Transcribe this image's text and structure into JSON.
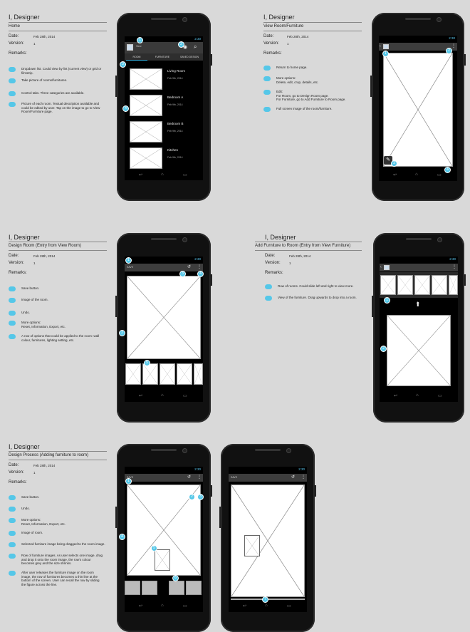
{
  "panels": [
    {
      "title": "I, Designer",
      "screen": "Home",
      "date_label": "Date:",
      "date": "Feb 28th, 2014",
      "version_label": "Version:",
      "version": "1",
      "remarks_label": "Remarks:",
      "remarks": [
        "Dropdown list. Could view by list (current view) or grid or filmstrip.",
        "Take picture of rooms/furnitures.",
        "Control tabs. Three categories are available.",
        "Picture of each room. Textual description available and could be edited by user. Tap on the image to go to View Room/Furniture page."
      ],
      "phone": {
        "status_time": "2:30",
        "action_dropdown": "View",
        "tabs": [
          "ROOM",
          "FURNITURE",
          "SAVED DESIGN"
        ],
        "list": [
          {
            "title": "Living Room",
            "date": "Feb 9th, 2014"
          },
          {
            "title": "Bedroom A",
            "date": "Feb 9th, 2014"
          },
          {
            "title": "Bedroom B",
            "date": "Feb 9th, 2014"
          },
          {
            "title": "Kitchen",
            "date": "Feb 9th, 2014"
          }
        ],
        "annotations": [
          "1",
          "2",
          "3",
          "4"
        ]
      }
    },
    {
      "title": "I, Designer",
      "screen": "View Room/Furniture",
      "date_label": "Date:",
      "date": "Feb 28th, 2014",
      "version_label": "Version:",
      "version": "1",
      "remarks_label": "Remarks:",
      "remarks": [
        "Return to home page.",
        "More options:\nDelete, edit, crop, details, etc.",
        "Edit:\nFor Room, go to Design Room page.\nFor Furniture, go to Add Furniture to Room page.",
        "Full screen image of the room/furniture."
      ],
      "phone": {
        "status_time": "2:30",
        "annotations": [
          "1",
          "2",
          "3",
          "4"
        ]
      }
    },
    {
      "title": "I, Designer",
      "screen": "Design Room (Entry from View Room)",
      "date_label": "Date:",
      "date": "Feb 28th, 2014",
      "version_label": "Version:",
      "version": "1",
      "remarks_label": "Remarks:",
      "remarks": [
        "Save button.",
        "Image of the room.",
        "Undo.",
        "More options:\nReset, Information, Export, etc.",
        "A row of options that could be applied to the room: wall colour, furnitures, lighting setting, etc."
      ],
      "phone": {
        "status_time": "2:30",
        "save_label": "SAVE",
        "annotations": [
          "1",
          "2",
          "3",
          "4",
          "5"
        ]
      }
    },
    {
      "title": "I, Designer",
      "screen": "Add Furniture to Room (Entry from View Furniture)",
      "date_label": "Date:",
      "date": "Feb 28th, 2014",
      "version_label": "Version:",
      "version": "1",
      "remarks_label": "Remarks:",
      "remarks": [
        "Row of rooms. Could slide left and right to view more.",
        "View of the furniture. Drag upwards to drop into a room."
      ],
      "phone": {
        "status_time": "2:30",
        "annotations": [
          "1",
          "2"
        ]
      }
    },
    {
      "title": "I, Designer",
      "screen": "Design Process (Adding furniture to room)",
      "date_label": "Date:",
      "date": "Feb 28th, 2014",
      "version_label": "Version:",
      "version": "1",
      "remarks_label": "Remarks:",
      "remarks": [
        "Save button.",
        "Undo.",
        "More options:\nReset, Information, Export, etc.",
        "Image of room.",
        "Selected furniture image being dragged to the room image.",
        "Row of furniture images. As user selects one image, drag and drop it onto the room image, the row's colour becomes grey and the size shrinks.",
        "After user releases the furniture image on the room image, the row of furnitures becomes a thin line at the bottom of the screen. User can recall the row by sliding the figure across the line."
      ],
      "phone": {
        "status_time": "2:30",
        "save_label": "SAVE",
        "annotations": [
          "1",
          "2",
          "3",
          "4",
          "5",
          "6",
          "7"
        ]
      },
      "phone2": {
        "status_time": "2:30",
        "save_label": "SAVE",
        "annotations": [
          "7"
        ]
      }
    }
  ]
}
